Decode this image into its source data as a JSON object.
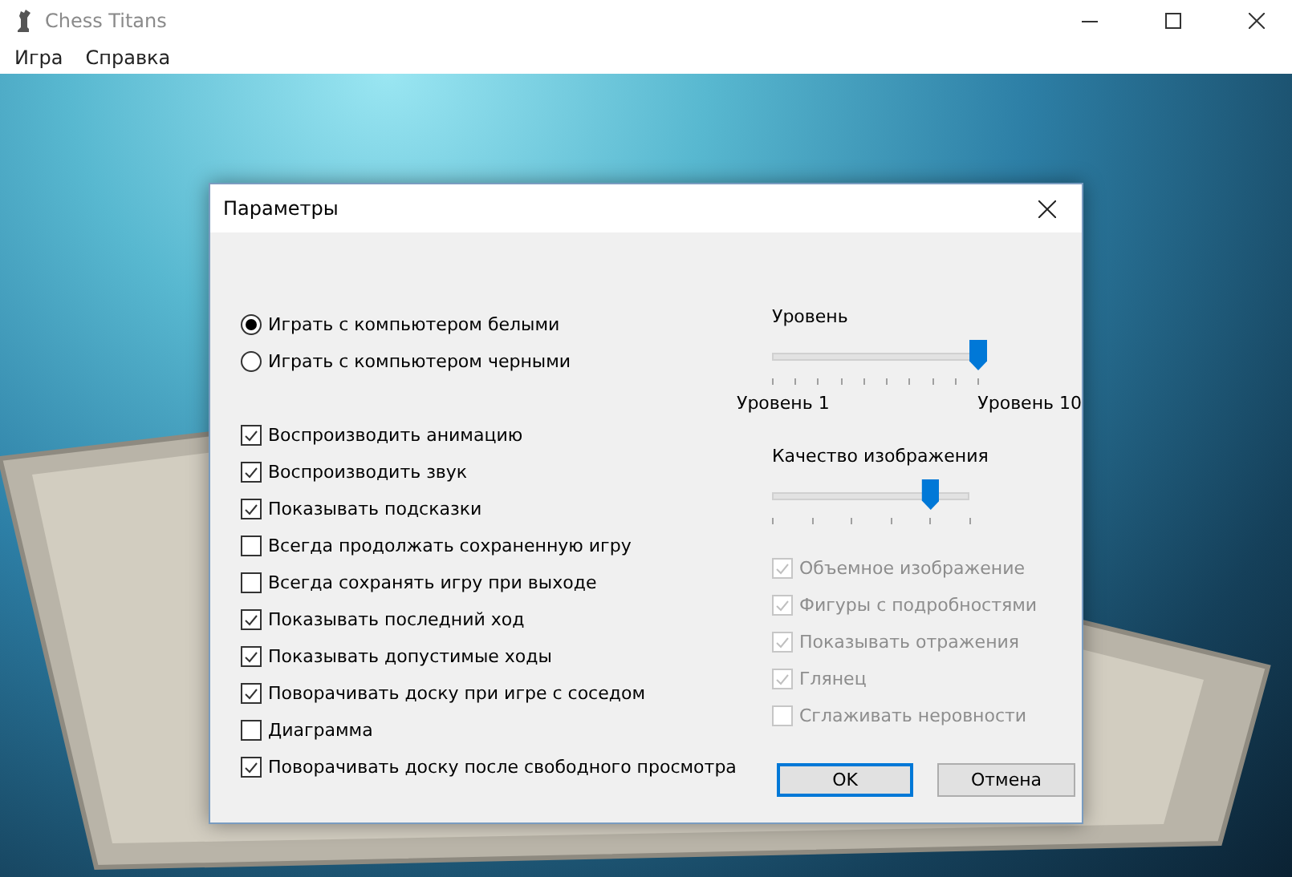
{
  "window": {
    "title": "Chess Titans"
  },
  "menu": [
    "Игра",
    "Справка"
  ],
  "dialog": {
    "title": "Параметры",
    "radios": [
      {
        "label": "Играть с компьютером белыми",
        "selected": true
      },
      {
        "label": "Играть с компьютером черными",
        "selected": false
      }
    ],
    "options": [
      {
        "label": "Воспроизводить анимацию",
        "checked": true
      },
      {
        "label": "Воспроизводить звук",
        "checked": true
      },
      {
        "label": "Показывать подсказки",
        "checked": true
      },
      {
        "label": "Всегда продолжать сохраненную игру",
        "checked": false
      },
      {
        "label": "Всегда сохранять игру при выходе",
        "checked": false
      },
      {
        "label": "Показывать последний ход",
        "checked": true
      },
      {
        "label": "Показывать допустимые ходы",
        "checked": true
      },
      {
        "label": "Поворачивать доску при игре с соседом",
        "checked": true
      },
      {
        "label": "Диаграмма",
        "checked": false
      },
      {
        "label": "Поворачивать доску после свободного просмотра",
        "checked": true
      }
    ],
    "level": {
      "label": "Уровень",
      "level": 1,
      "min_label": "Уровень 1",
      "max_label": "Уровень 10"
    },
    "quality": {
      "label": "Качество изображения",
      "level": 0.8
    },
    "graphics_options": [
      {
        "label": "Объемное изображение",
        "checked": true,
        "disabled": true
      },
      {
        "label": "Фигуры с подробностями",
        "checked": true,
        "disabled": true
      },
      {
        "label": "Показывать отражения",
        "checked": true,
        "disabled": true
      },
      {
        "label": "Глянец",
        "checked": true,
        "disabled": true
      },
      {
        "label": "Сглаживать неровности",
        "checked": false,
        "disabled": true
      }
    ],
    "buttons": [
      {
        "label": "OK",
        "default": true
      },
      {
        "label": "Отмена",
        "default": false
      }
    ]
  }
}
